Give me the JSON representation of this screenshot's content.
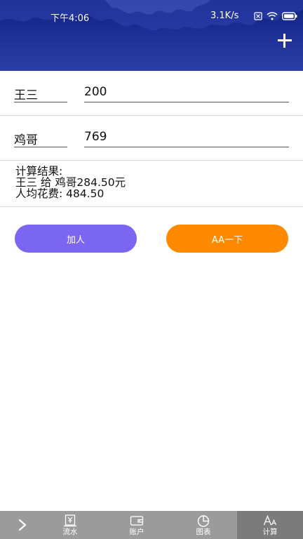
{
  "status_bar": {
    "time": "下午4:06",
    "network_speed": "3.1K/s"
  },
  "rows": [
    {
      "name": "王三",
      "amount": "200"
    },
    {
      "name": "鸡哥",
      "amount": "769"
    }
  ],
  "result": {
    "heading": "计算结果:",
    "transfer": "王三 给 鸡哥284.50元",
    "average": "人均花费: 484.50"
  },
  "buttons": {
    "add_person": "加人",
    "split": "AA一下"
  },
  "bottom_nav": [
    {
      "label": "流水",
      "icon": "ledger-icon"
    },
    {
      "label": "账户",
      "icon": "wallet-icon"
    },
    {
      "label": "图表",
      "icon": "pie-chart-icon"
    },
    {
      "label": "计算",
      "icon": "font-size-icon",
      "active": true
    }
  ],
  "colors": {
    "header": "#1d2f96",
    "add_person_button": "#7b66f2",
    "split_button": "#ff8a00",
    "bottom_nav": "#9b9b9b",
    "bottom_nav_active": "#7b7b7b"
  }
}
